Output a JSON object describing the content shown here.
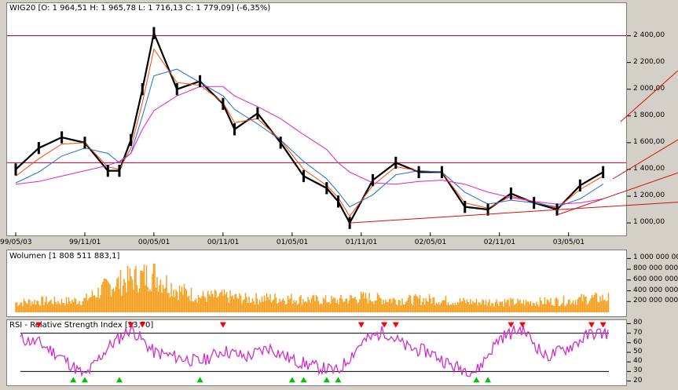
{
  "colors": {
    "price": "#000000",
    "sma_short": "#ff4500",
    "sma_mid": "#1f6fd0",
    "sma_long": "#e020d0",
    "hline": "#c00030",
    "trend": "#d01010",
    "volume": "#f5a020",
    "rsi": "#d030c8",
    "rsi_high_marker": "#ff0000",
    "rsi_low_marker": "#00c000"
  },
  "chart_data": [
    {
      "type": "line",
      "title": "WIG20 [O: 1 964,51  H: 1 965,78  L: 1 716,13  C: 1 779,09] (-6,35%)",
      "x_tick_labels": [
        "99/05/03",
        "99/11/01",
        "00/05/01",
        "00/11/01",
        "01/05/01",
        "01/11/01",
        "02/05/01",
        "02/11/01",
        "03/05/01"
      ],
      "y_tick_labels": [
        "1 000,00",
        "1 200,00",
        "1 400,00",
        "1 600,00",
        "1 800,00",
        "2 000,00",
        "2 200,00",
        "2 400,00"
      ],
      "ylim": [
        930,
        2550
      ],
      "x": [
        "1999-05",
        "1999-07",
        "1999-09",
        "1999-11",
        "2000-01",
        "2000-02",
        "2000-03",
        "2000-04",
        "2000-05",
        "2000-07",
        "2000-09",
        "2000-11",
        "2000-12",
        "2001-02",
        "2001-04",
        "2001-06",
        "2001-08",
        "2001-09",
        "2001-10",
        "2001-12",
        "2002-02",
        "2002-04",
        "2002-06",
        "2002-08",
        "2002-10",
        "2002-12",
        "2003-02",
        "2003-04",
        "2003-06",
        "2003-08"
      ],
      "series": [
        {
          "values": [
            1400,
            1560,
            1640,
            1600,
            1390,
            1390,
            1620,
            2000,
            2420,
            2000,
            2060,
            1890,
            1700,
            1820,
            1600,
            1350,
            1260,
            1160,
            1000,
            1320,
            1450,
            1380,
            1380,
            1120,
            1100,
            1220,
            1150,
            1100,
            1280,
            1380
          ]
        },
        {
          "values": [
            1350,
            1480,
            1590,
            1600,
            1420,
            1400,
            1560,
            1900,
            2300,
            2050,
            2030,
            1900,
            1750,
            1780,
            1620,
            1400,
            1280,
            1190,
            1050,
            1280,
            1420,
            1390,
            1380,
            1150,
            1110,
            1200,
            1160,
            1110,
            1250,
            1350
          ]
        },
        {
          "values": [
            1300,
            1380,
            1500,
            1560,
            1520,
            1450,
            1520,
            1800,
            2100,
            2150,
            2050,
            1950,
            1850,
            1740,
            1620,
            1460,
            1330,
            1230,
            1120,
            1210,
            1360,
            1390,
            1380,
            1230,
            1140,
            1170,
            1150,
            1120,
            1180,
            1290
          ]
        },
        {
          "values": [
            1290,
            1310,
            1350,
            1390,
            1430,
            1460,
            1520,
            1700,
            1840,
            1950,
            2020,
            2020,
            1950,
            1870,
            1780,
            1660,
            1550,
            1450,
            1380,
            1300,
            1290,
            1310,
            1320,
            1290,
            1230,
            1190,
            1160,
            1140,
            1150,
            1180
          ]
        }
      ],
      "horizontal_lines": [
        2400,
        1450
      ],
      "trendlines": [
        {
          "from": [
            "2001-10",
            1000
          ],
          "to": [
            "2003-08",
            1120
          ]
        },
        {
          "from": [
            "2003-04",
            1060
          ],
          "to": [
            "2003-08",
            1180
          ]
        }
      ],
      "grid": false
    },
    {
      "type": "bar",
      "title": "Wolumen [1 808 511 883,1]",
      "y_tick_labels": [
        "200 000 000",
        "400 000 000",
        "600 000 000",
        "800 000 000",
        "1 000 000 000"
      ],
      "ylim": [
        0,
        1050000000
      ],
      "x": [
        "1999-05",
        "1999-07",
        "1999-09",
        "1999-11",
        "2000-01",
        "2000-03",
        "2000-05",
        "2000-07",
        "2000-09",
        "2000-11",
        "2001-01",
        "2001-03",
        "2001-05",
        "2001-07",
        "2001-09",
        "2001-11",
        "2002-01",
        "2002-03",
        "2002-05",
        "2002-07",
        "2002-09",
        "2002-11",
        "2003-01",
        "2003-03",
        "2003-05",
        "2003-07"
      ],
      "values": [
        180000000,
        210000000,
        200000000,
        230000000,
        480000000,
        620000000,
        700000000,
        420000000,
        290000000,
        300000000,
        250000000,
        260000000,
        250000000,
        230000000,
        220000000,
        280000000,
        240000000,
        230000000,
        240000000,
        210000000,
        190000000,
        200000000,
        180000000,
        200000000,
        220000000,
        260000000
      ],
      "grid": false
    },
    {
      "type": "line",
      "title": "RSI - Relative Strength Index [13,70]",
      "y_tick_labels": [
        "20",
        "30",
        "40",
        "50",
        "60",
        "70",
        "80"
      ],
      "ylim": [
        18,
        82
      ],
      "x": [
        "1999-05",
        "1999-07",
        "1999-09",
        "1999-11",
        "2000-01",
        "2000-03",
        "2000-05",
        "2000-07",
        "2000-09",
        "2000-11",
        "2001-01",
        "2001-03",
        "2001-05",
        "2001-07",
        "2001-09",
        "2001-11",
        "2002-01",
        "2002-03",
        "2002-05",
        "2002-07",
        "2002-09",
        "2002-11",
        "2003-01",
        "2003-03",
        "2003-05",
        "2003-07"
      ],
      "values": [
        65,
        60,
        45,
        25,
        55,
        75,
        50,
        45,
        40,
        52,
        45,
        55,
        42,
        35,
        30,
        60,
        72,
        55,
        50,
        35,
        30,
        65,
        75,
        45,
        55,
        70
      ],
      "reference_lines": [
        70,
        30
      ],
      "overbought_markers": [
        "1999-07",
        "2000-03",
        "2000-04",
        "2000-11",
        "2001-11",
        "2002-01",
        "2002-02",
        "2002-12",
        "2003-01",
        "2003-07",
        "2003-08"
      ],
      "oversold_markers": [
        "1999-10",
        "1999-11",
        "2000-02",
        "2000-09",
        "2001-05",
        "2001-06",
        "2001-08",
        "2001-09",
        "2002-09",
        "2002-10"
      ],
      "grid": false
    }
  ]
}
